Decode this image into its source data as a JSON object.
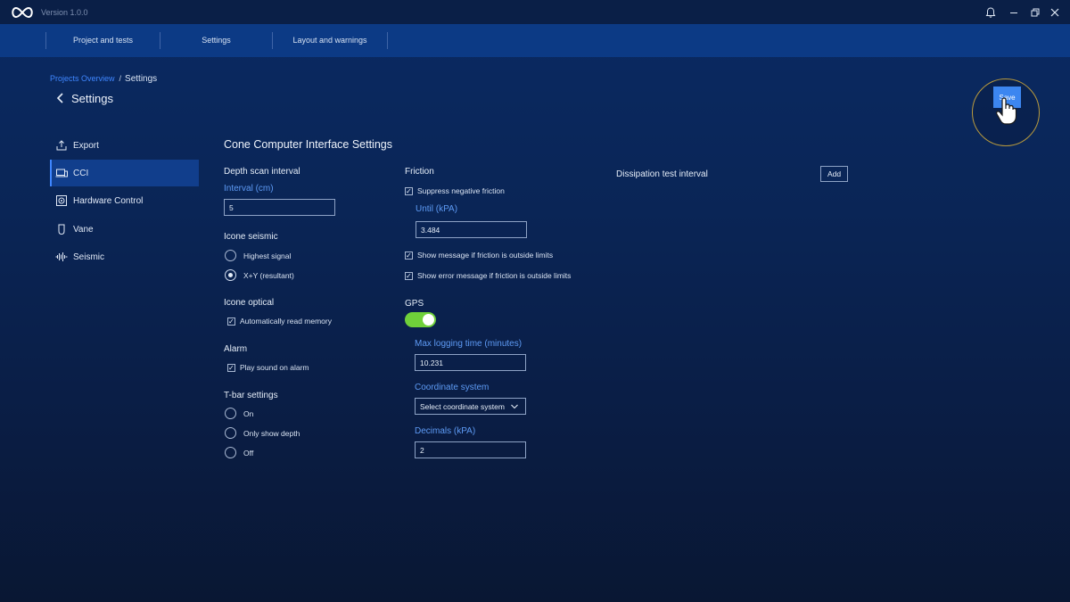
{
  "titlebar": {
    "version": "Version 1.0.0"
  },
  "topnav": {
    "tabs": [
      {
        "label": "Project and tests"
      },
      {
        "label": "Settings"
      },
      {
        "label": "Layout and warnings"
      }
    ]
  },
  "breadcrumb": {
    "link": "Projects Overview",
    "separator": "/",
    "current": "Settings"
  },
  "page": {
    "title": "Settings"
  },
  "sidebar": {
    "items": [
      {
        "label": "Export",
        "icon": "export-icon"
      },
      {
        "label": "CCI",
        "icon": "computer-icon",
        "active": true
      },
      {
        "label": "Hardware Control",
        "icon": "hardware-icon"
      },
      {
        "label": "Vane",
        "icon": "vane-icon"
      },
      {
        "label": "Seismic",
        "icon": "seismic-icon"
      }
    ]
  },
  "content": {
    "title": "Cone Computer Interface Settings",
    "depth": {
      "label": "Depth scan interval",
      "sublabel": "Interval (cm)",
      "value": "5"
    },
    "icone_seismic": {
      "label": "Icone seismic",
      "options": [
        "Highest signal",
        "X+Y (resultant)"
      ],
      "selected": "X+Y (resultant)"
    },
    "icone_optical": {
      "label": "Icone optical",
      "check": "Automatically read memory"
    },
    "alarm": {
      "label": "Alarm",
      "check": "Play sound on alarm"
    },
    "tbar": {
      "label": "T-bar settings",
      "options": [
        "On",
        "Only show depth",
        "Off"
      ]
    },
    "friction": {
      "label": "Friction",
      "suppress": "Suppress negative friction",
      "until_label": "Until (kPA)",
      "until_value": "3.484",
      "show_message": "Show message if friction is outside limits",
      "show_error": "Show error message if friction is outside limits"
    },
    "gps": {
      "label": "GPS",
      "enabled": true,
      "max_logging_label": "Max logging time (minutes)",
      "max_logging_value": "10.231",
      "coord_label": "Coordinate system",
      "coord_value": "Select coordinate system",
      "decimals_label": "Decimals (kPA)",
      "decimals_value": "2"
    },
    "dissipation": {
      "label": "Dissipation test interval",
      "add_label": "Add"
    }
  },
  "save": {
    "label": "Save"
  },
  "colors": {
    "accent": "#3f86ff",
    "toggle_on": "#6fd03a",
    "nav_bg": "#0c3a85"
  }
}
